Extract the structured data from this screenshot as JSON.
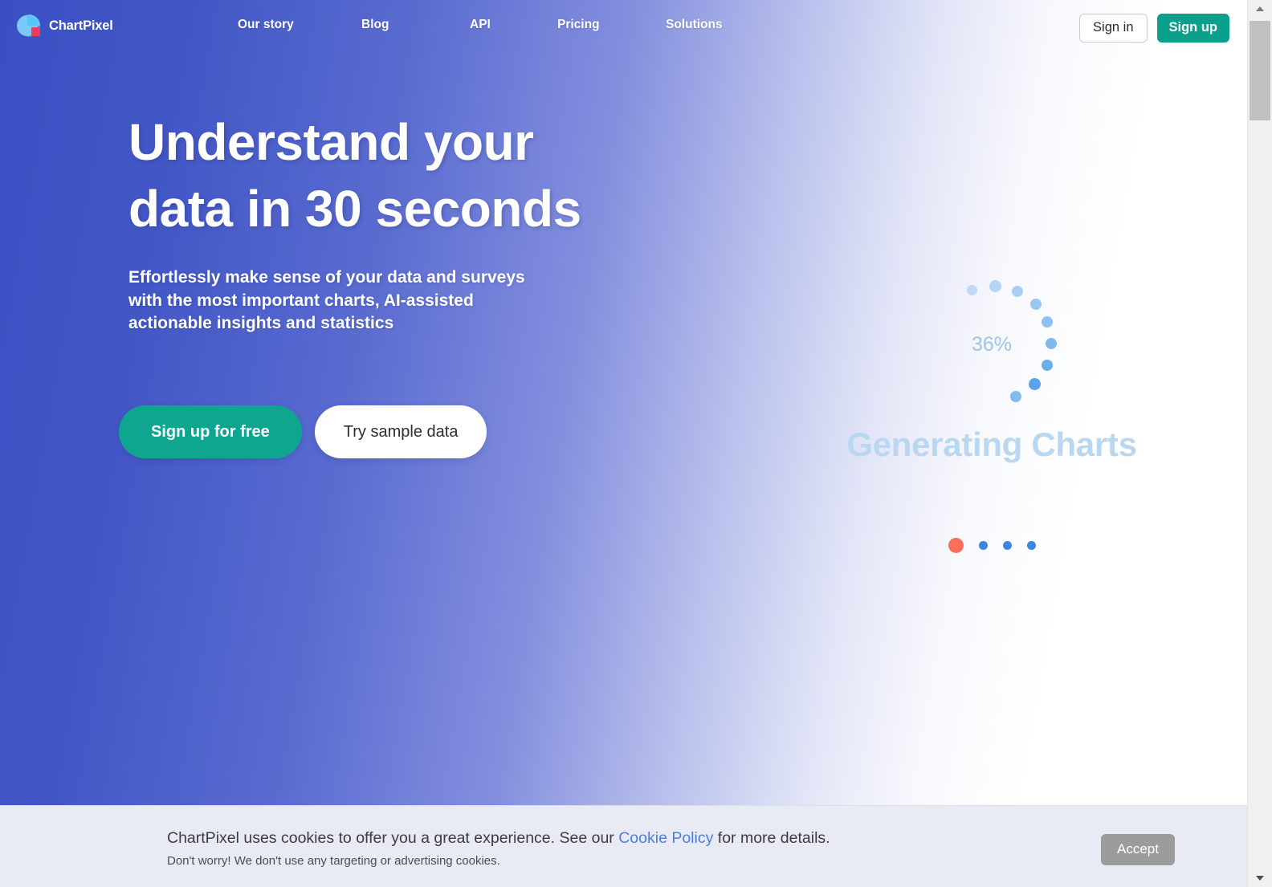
{
  "header": {
    "brand": {
      "name": "ChartPixel",
      "logo_icon": "pie-chart-logo-icon",
      "logo_colors": {
        "pie": "#6ec6f5",
        "pie_light": "#a8dcf8",
        "square": "#ef3b5b"
      }
    },
    "nav": [
      {
        "label": "Our story"
      },
      {
        "label": "Blog"
      },
      {
        "label": "API"
      },
      {
        "label": "Pricing"
      },
      {
        "label": "Solutions"
      }
    ],
    "auth": {
      "signin_label": "Sign in",
      "signup_label": "Sign up",
      "signup_color": "#0aa08c"
    }
  },
  "hero": {
    "headline_line1": "Understand your",
    "headline_line2": "data in 30 seconds",
    "subhead_line1": "Effortlessly make sense of your data and surveys",
    "subhead_line2": "with the most important charts, AI-assisted",
    "subhead_line3": "actionable insights and statistics",
    "cta_primary": "Sign up for free",
    "cta_secondary": "Try sample data",
    "gradient_start": "#3a4fc2",
    "gradient_end": "#ffffff"
  },
  "loading_visual": {
    "percent_label": "36%",
    "percent_value": 36,
    "status_text": "Generating Charts",
    "spinner_icon": "dot-ring-spinner-icon",
    "spinner_color": "#4a9ce8",
    "status_color": "#bad7f2",
    "carousel": {
      "count": 4,
      "active_index": 0,
      "active_color": "#f9705a",
      "inactive_color": "#3d85e0"
    }
  },
  "cookie_banner": {
    "message_before_link": "ChartPixel uses cookies to offer you a great experience. See our ",
    "link_label": "Cookie Policy",
    "message_after_link": " for more details.",
    "subtext": "Don't worry! We don't use any targeting or advertising cookies.",
    "accept_label": "Accept"
  },
  "scrollbar": {
    "up_arrow_icon": "scroll-up-arrow-icon",
    "down_arrow_icon": "scroll-down-arrow-icon"
  }
}
